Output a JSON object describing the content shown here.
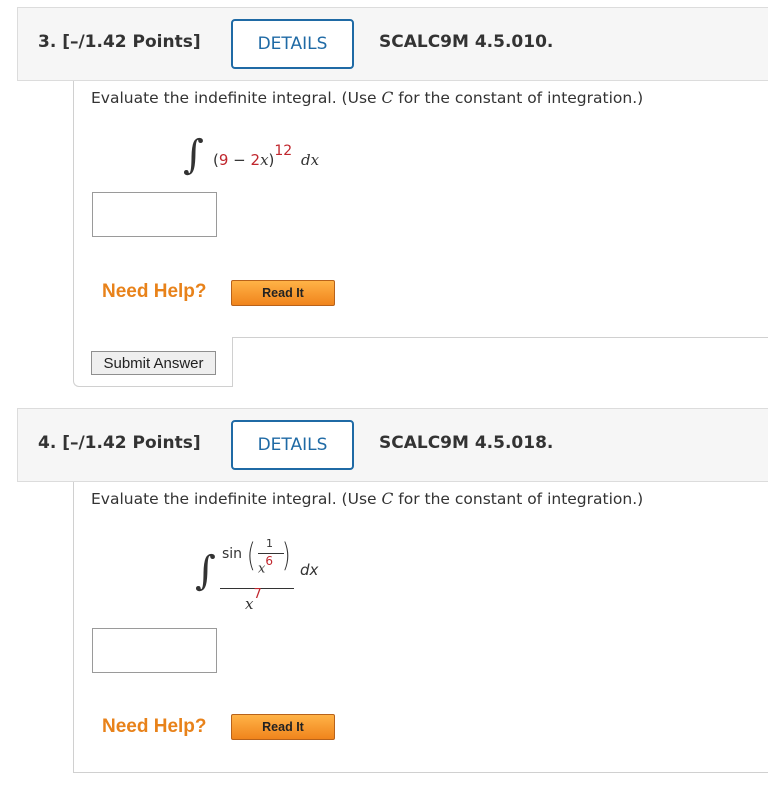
{
  "questions": [
    {
      "title": "3. [–/1.42 Points]",
      "details_label": "DETAILS",
      "code": "SCALC9M 4.5.010.",
      "prompt_prefix": "Evaluate the indefinite integral. (Use ",
      "prompt_var": "C",
      "prompt_suffix": " for the constant of integration.)",
      "integrand": {
        "open": "(",
        "a": "9",
        "minus": " − ",
        "b": "2",
        "var": "x",
        "close": ")",
        "exponent": "12",
        "d": "dx"
      },
      "need_help": "Need Help?",
      "read_it": "Read It",
      "submit": "Submit Answer"
    },
    {
      "title": "4. [–/1.42 Points]",
      "details_label": "DETAILS",
      "code": "SCALC9M 4.5.018.",
      "prompt_prefix": "Evaluate the indefinite integral. (Use ",
      "prompt_var": "C",
      "prompt_suffix": " for the constant of integration.)",
      "integrand": {
        "func": "sin",
        "inner_num": "1",
        "inner_den_var": "x",
        "inner_den_exp": "6",
        "den_var": "x",
        "den_exp": "7",
        "d": "dx"
      },
      "need_help": "Need Help?",
      "read_it": "Read It"
    }
  ]
}
